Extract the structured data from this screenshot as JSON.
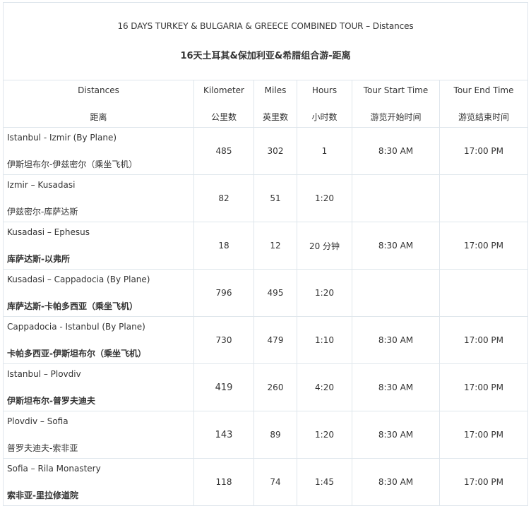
{
  "title": {
    "en": "16 DAYS TURKEY & BULGARIA & GREECE COMBINED TOUR – Distances",
    "zh": "16天土耳其&保加利亚&希腊组合游-距离"
  },
  "headers": [
    {
      "en": "Distances",
      "zh": "距离"
    },
    {
      "en": "Kilometer",
      "zh": "公里数"
    },
    {
      "en": "Miles",
      "zh": "英里数"
    },
    {
      "en": "Hours",
      "zh": "小时数"
    },
    {
      "en": "Tour Start Time",
      "zh": "游览开始时间"
    },
    {
      "en": "Tour End Time",
      "zh": "游览结束时间"
    }
  ],
  "rows": [
    {
      "route_en": "Istanbul  - Izmir (By Plane)",
      "route_zh": "伊斯坦布尔-伊兹密尔（乘坐飞机）",
      "km": "485",
      "miles": "302",
      "hours": "1",
      "start": "8:30 AM",
      "end": "17:00 PM"
    },
    {
      "route_en": "Izmir  – Kusadasi",
      "route_zh": "伊兹密尔-库萨达斯",
      "km": "82",
      "miles": "51",
      "hours": "1:20",
      "start": "",
      "end": ""
    },
    {
      "route_en": "Kusadasi  – Ephesus",
      "route_zh": "库萨达斯-以弗所",
      "km": "18",
      "miles": "12",
      "hours": "20 分钟",
      "start": "8:30 AM",
      "end": "17:00 PM"
    },
    {
      "route_en": "Kusadasi – Cappadocia (By  Plane)",
      "route_zh": "库萨达斯-卡帕多西亚（乘坐飞机）",
      "km": "796",
      "miles": "495",
      "hours": "1:20",
      "start": "",
      "end": ""
    },
    {
      "route_en": "Cappadocia - Istanbul (By  Plane)",
      "route_zh": "卡帕多西亚-伊斯坦布尔（乘坐飞机）",
      "km": "730",
      "miles": "479",
      "hours": "1:10",
      "start": "8:30 AM",
      "end": "17:00 PM"
    },
    {
      "route_en": "Istanbul – Plovdiv",
      "route_zh": "伊斯坦布尔-普罗夫迪夫",
      "km": "419",
      "miles": "260",
      "hours": "4:20",
      "start": "8:30 AM",
      "end": "17:00 PM"
    },
    {
      "route_en": "Plovdiv – Sofia",
      "route_zh": "普罗夫迪夫-索非亚",
      "km": "143",
      "miles": "89",
      "hours": "1:20",
      "start": "8:30 AM",
      "end": "17:00 PM"
    },
    {
      "route_en": "Sofia  – Rila Monastery",
      "route_zh": "索非亚-里拉修道院",
      "km": "118",
      "miles": "74",
      "hours": "1:45",
      "start": "8:30 AM",
      "end": "17:00 PM"
    }
  ]
}
